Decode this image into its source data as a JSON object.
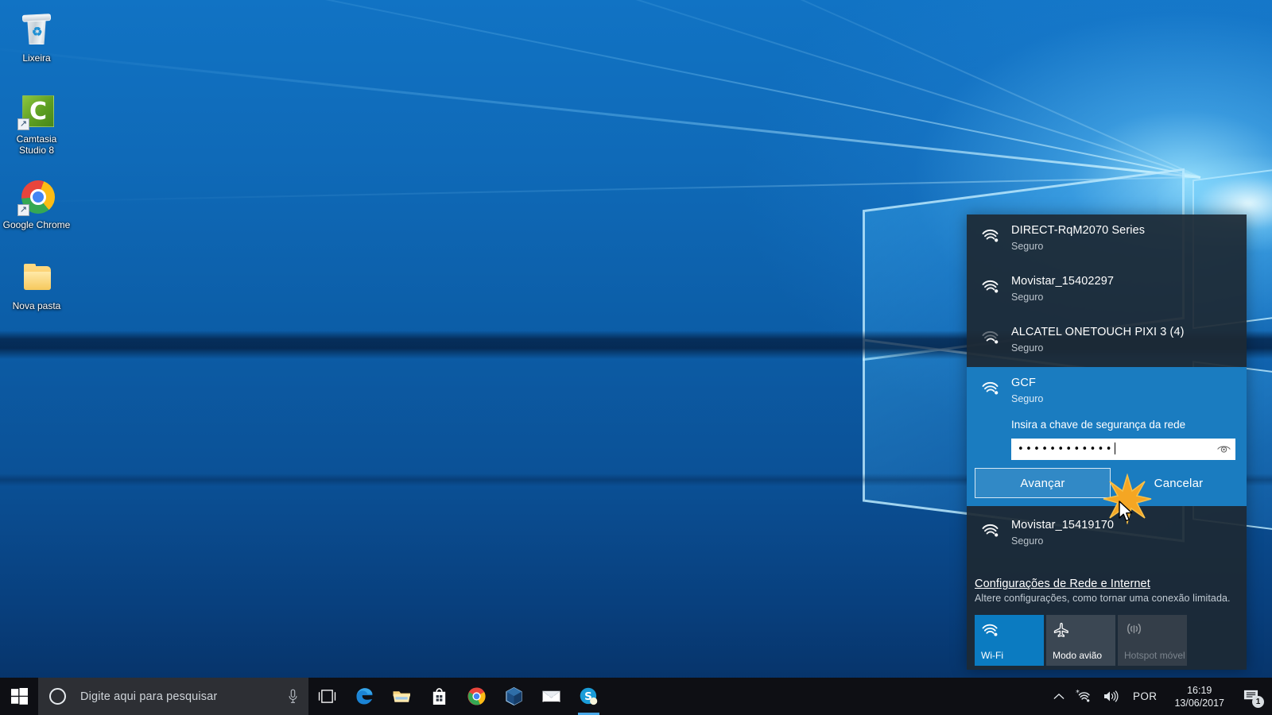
{
  "desktop": {
    "icons": [
      {
        "label": "Lixeira",
        "icon": "recycle-bin-icon"
      },
      {
        "label": "Camtasia Studio 8",
        "icon": "camtasia-icon"
      },
      {
        "label": "Google Chrome",
        "icon": "chrome-icon"
      },
      {
        "label": "Nova pasta",
        "icon": "folder-icon"
      }
    ]
  },
  "wifi_flyout": {
    "networks_top": [
      {
        "name": "DIRECT-RqM2070 Series",
        "status": "Seguro",
        "signal": 4
      },
      {
        "name": "Movistar_15402297",
        "status": "Seguro",
        "signal": 4
      },
      {
        "name": "ALCATEL ONETOUCH PIXI 3 (4)",
        "status": "Seguro",
        "signal": 2
      }
    ],
    "selected_network": {
      "name": "GCF",
      "status": "Seguro",
      "signal": 4,
      "password_prompt": "Insira a chave de segurança da rede",
      "password_value": "••••••••••••",
      "password_char_count": 12,
      "reveal_icon": "eye-icon",
      "next_label": "Avançar",
      "cancel_label": "Cancelar"
    },
    "networks_bottom": [
      {
        "name": "Movistar_15419170",
        "status": "Seguro",
        "signal": 4
      }
    ],
    "settings_link": "Configurações de Rede e Internet",
    "settings_desc": "Altere configurações, como tornar uma conexão limitada.",
    "tiles": [
      {
        "label": "Wi-Fi",
        "icon": "wifi-icon",
        "state": "active"
      },
      {
        "label": "Modo avião",
        "icon": "airplane-icon",
        "state": "inactive"
      },
      {
        "label": "Hotspot móvel",
        "icon": "hotspot-icon",
        "state": "disabled"
      }
    ],
    "accent_color": "#0b7bc1",
    "panel_color": "#1d2934"
  },
  "taskbar": {
    "start_icon": "windows-logo-icon",
    "search_placeholder": "Digite aqui para pesquisar",
    "cortana_icon": "cortana-ring-icon",
    "mic_icon": "microphone-icon",
    "apps": [
      {
        "name": "task-view",
        "icon": "task-view-icon",
        "running": false
      },
      {
        "name": "edge",
        "icon": "edge-icon",
        "running": false
      },
      {
        "name": "file-explorer",
        "icon": "file-explorer-icon",
        "running": false
      },
      {
        "name": "microsoft-store",
        "icon": "store-icon",
        "running": false
      },
      {
        "name": "chrome",
        "icon": "chrome-icon",
        "running": false
      },
      {
        "name": "virtualbox",
        "icon": "virtualbox-icon",
        "running": false
      },
      {
        "name": "mail",
        "icon": "mail-icon",
        "running": false
      },
      {
        "name": "skype",
        "icon": "skype-icon",
        "running": true
      }
    ],
    "tray": {
      "chevron_icon": "chevron-up-icon",
      "wifi_icon": "wifi-icon",
      "volume_icon": "speaker-icon",
      "language": "POR",
      "time": "16:19",
      "date": "13/06/2017",
      "notification_icon": "action-center-icon",
      "notification_count": "1"
    }
  }
}
